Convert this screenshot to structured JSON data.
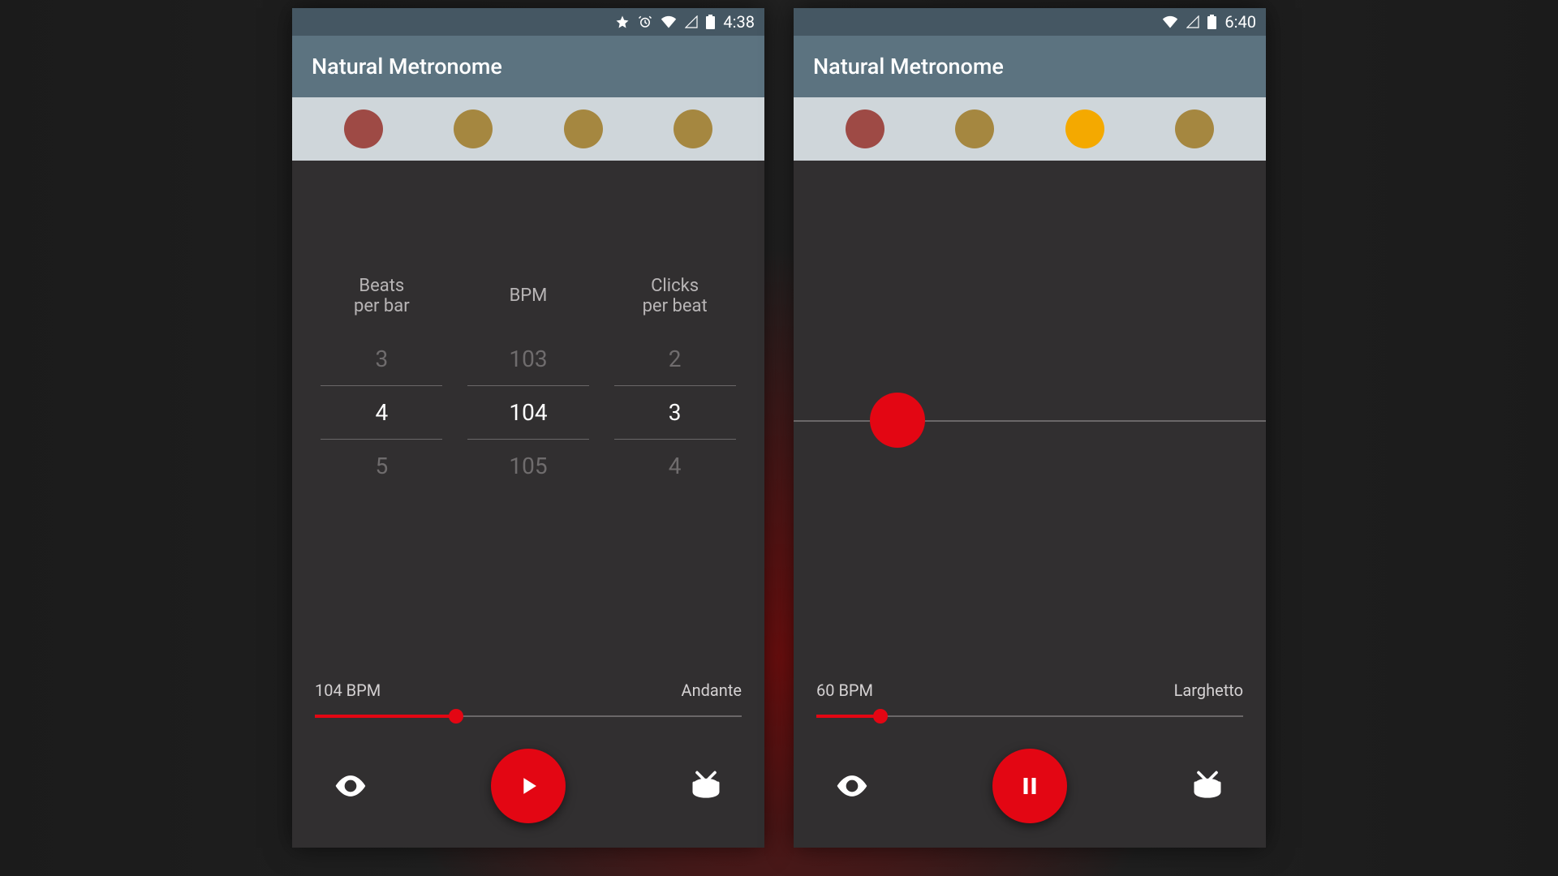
{
  "colors": {
    "accent": "#e30613",
    "beat_accent": "#9e4a45",
    "beat_normal": "#a58740",
    "beat_active": "#f4a900"
  },
  "left": {
    "status": {
      "time": "4:38",
      "show_star": true,
      "show_alarm": true
    },
    "title": "Natural Metronome",
    "beats": [
      {
        "color": "#9e4a45"
      },
      {
        "color": "#a58740"
      },
      {
        "color": "#a58740"
      },
      {
        "color": "#a58740"
      }
    ],
    "pickers": {
      "beats_per_bar": {
        "label": "Beats\nper bar",
        "above": "3",
        "selected": "4",
        "below": "5"
      },
      "bpm": {
        "label": "BPM",
        "above": "103",
        "selected": "104",
        "below": "105"
      },
      "clicks_per_beat": {
        "label": "Clicks\nper beat",
        "above": "2",
        "selected": "3",
        "below": "4"
      }
    },
    "tempo": {
      "bpm_label": "104 BPM",
      "tempo_name": "Andante",
      "slider_percent": 33
    },
    "playing": false
  },
  "right": {
    "status": {
      "time": "6:40",
      "show_star": false,
      "show_alarm": false
    },
    "title": "Natural Metronome",
    "beats": [
      {
        "color": "#9e4a45"
      },
      {
        "color": "#a58740"
      },
      {
        "color": "#f4a900"
      },
      {
        "color": "#a58740"
      }
    ],
    "pendulum": {
      "position_percent": 22
    },
    "tempo": {
      "bpm_label": "60 BPM",
      "tempo_name": "Larghetto",
      "slider_percent": 15
    },
    "playing": true
  }
}
